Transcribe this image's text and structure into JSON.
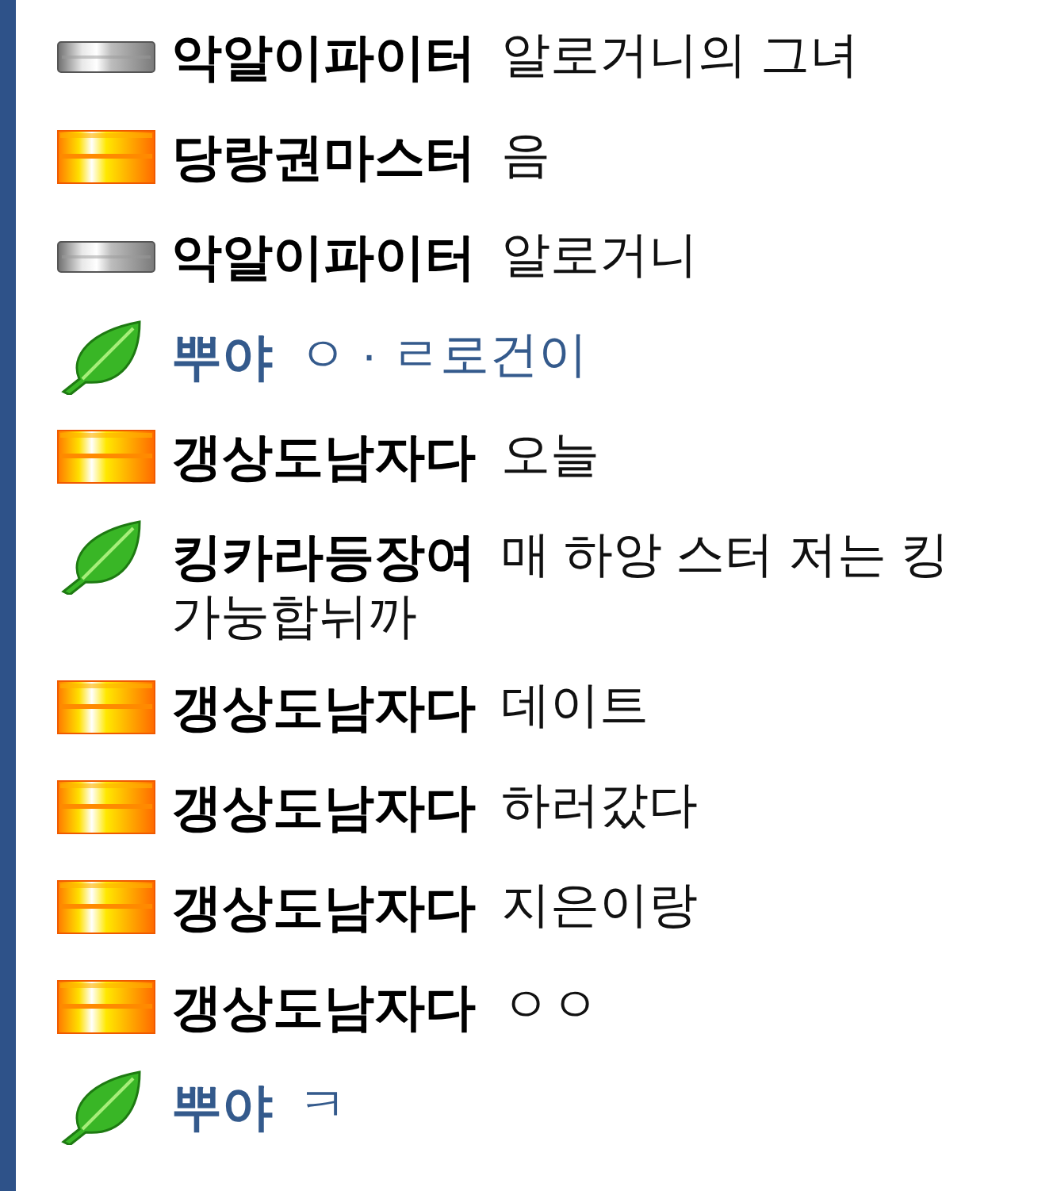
{
  "messages": [
    {
      "kind": "silver",
      "name": "악알이파이터",
      "highlighted": false,
      "text": "알로거니의 그녀"
    },
    {
      "kind": "gold",
      "name": "당랑권마스터",
      "highlighted": false,
      "text": "음"
    },
    {
      "kind": "silver",
      "name": "악알이파이터",
      "highlighted": false,
      "text": "알로거니"
    },
    {
      "kind": "leaf",
      "name": "뿌야",
      "highlighted": true,
      "text": "ㅇ · ㄹ로건이"
    },
    {
      "kind": "gold",
      "name": "갱상도남자다",
      "highlighted": false,
      "text": "오늘"
    },
    {
      "kind": "leaf",
      "name": "킹카라등장여",
      "highlighted": false,
      "text": "매 하앙 스터 저는 킹",
      "continuation": "가눙합뉘까"
    },
    {
      "kind": "gold",
      "name": "갱상도남자다",
      "highlighted": false,
      "text": "데이트"
    },
    {
      "kind": "gold",
      "name": "갱상도남자다",
      "highlighted": false,
      "text": "하러갔다"
    },
    {
      "kind": "gold",
      "name": "갱상도남자다",
      "highlighted": false,
      "text": "지은이랑"
    },
    {
      "kind": "gold",
      "name": "갱상도남자다",
      "highlighted": false,
      "text": "ㅇㅇ"
    },
    {
      "kind": "leaf",
      "name": "뿌야",
      "highlighted": true,
      "text": "ㅋ"
    }
  ]
}
